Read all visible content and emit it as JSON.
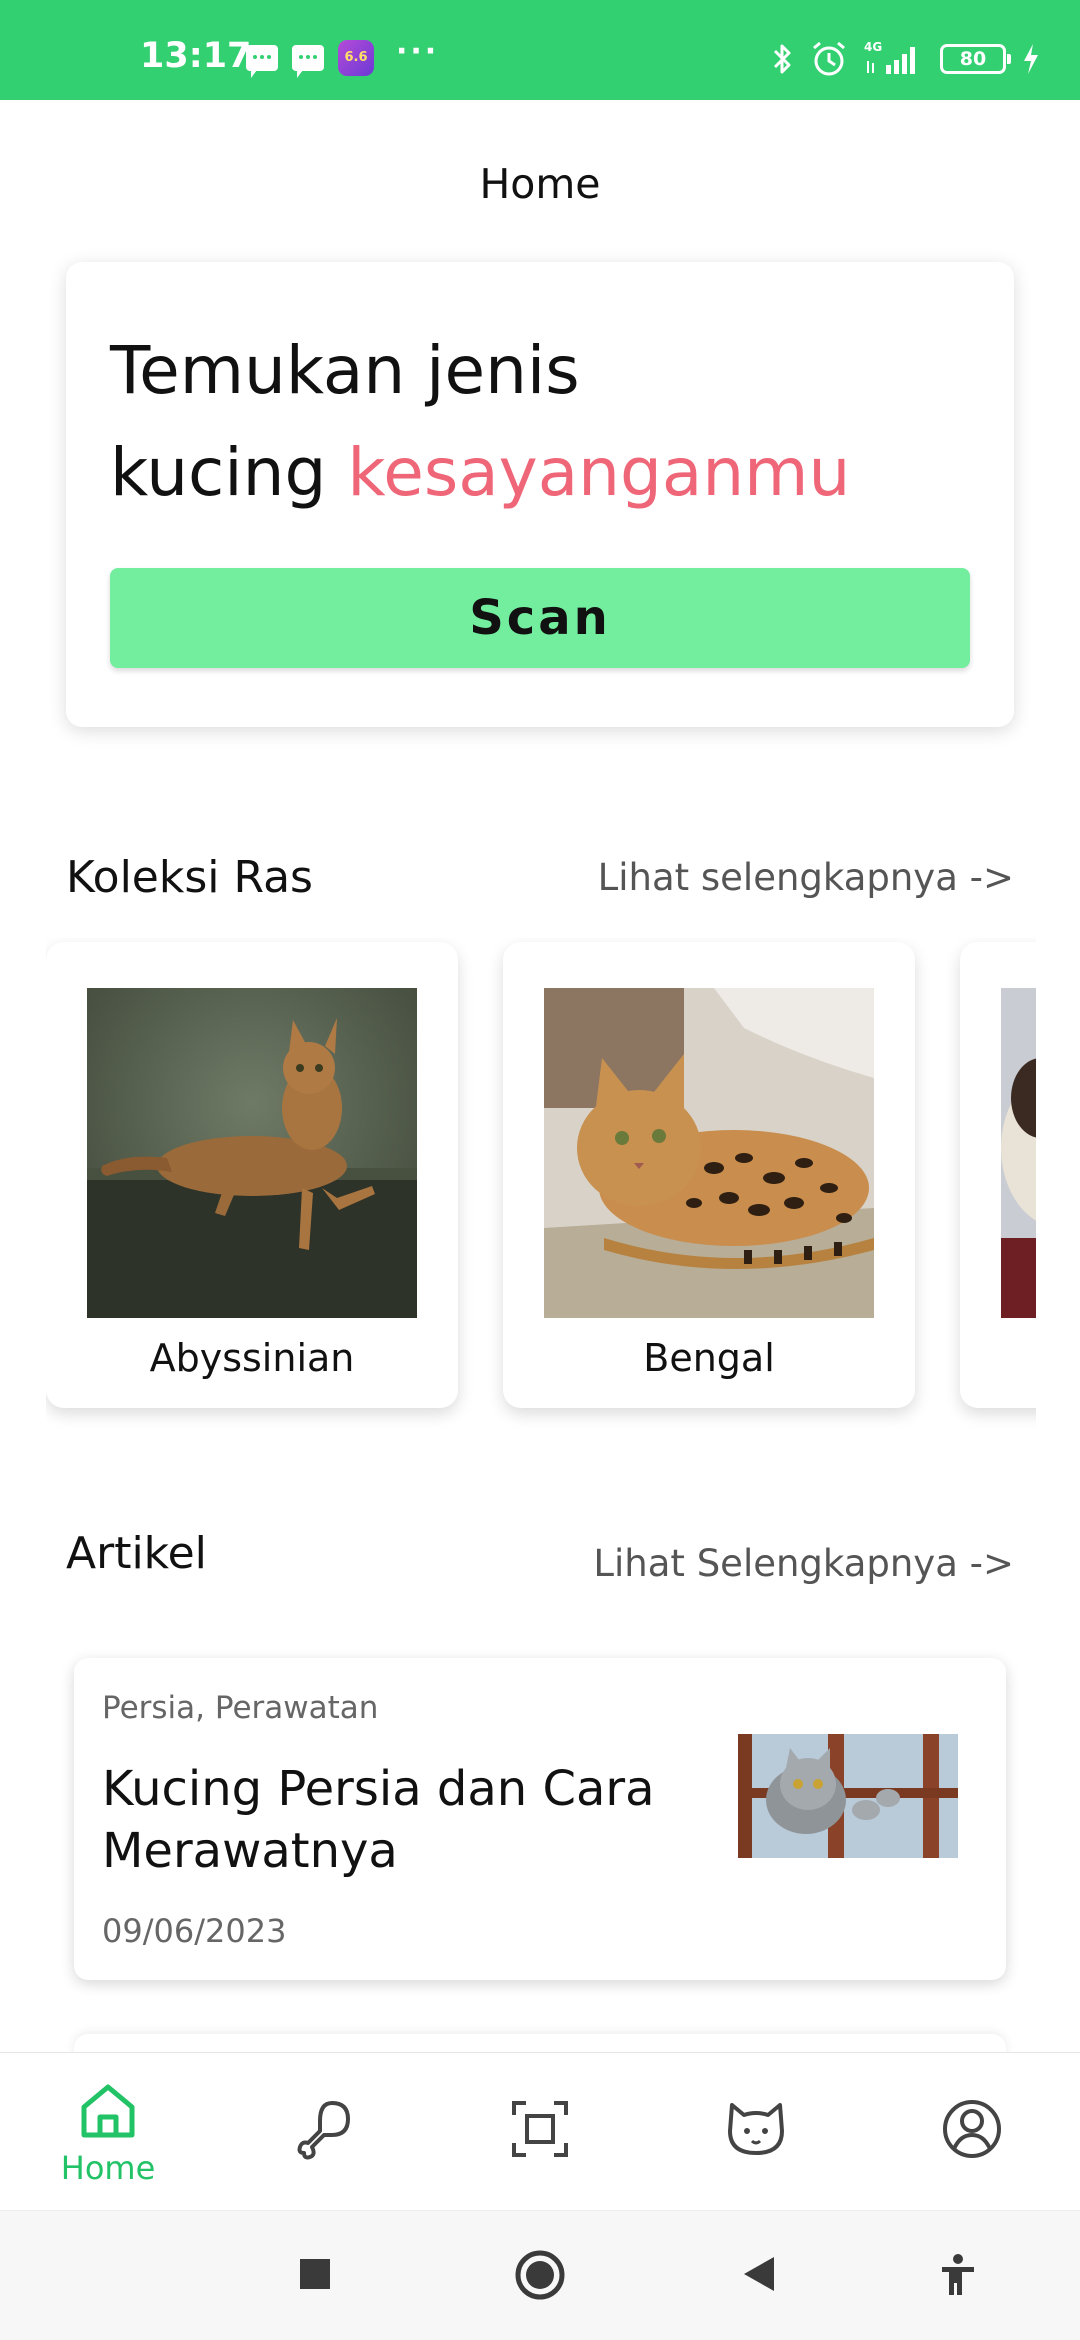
{
  "status_bar": {
    "time": "13:17",
    "app_badge": "6.6",
    "more": "···",
    "network": "4G",
    "battery": "80",
    "background": "#33d072"
  },
  "header": {
    "title": "Home"
  },
  "hero": {
    "title_line1": "Temukan jenis",
    "title_word": "kucing",
    "title_accent": "kesayanganmu",
    "accent_color": "#ee6677",
    "scan_label": "Scan",
    "scan_color": "#72ee9e"
  },
  "breeds": {
    "title": "Koleksi Ras",
    "more_link": "Lihat selengkapnya ->",
    "items": [
      {
        "name": "Abyssinian",
        "image": "abyssinian-cat-photo"
      },
      {
        "name": "Bengal",
        "image": "bengal-cat-photo"
      },
      {
        "name": "",
        "image": "siamese-cat-photo"
      }
    ]
  },
  "articles": {
    "title": "Artikel",
    "more_link": "Lihat Selengkapnya ->",
    "items": [
      {
        "tags": "Persia, Perawatan",
        "title": "Kucing Persia dan Cara Merawatnya",
        "date": "09/06/2023",
        "image": "persian-cat-photo"
      }
    ]
  },
  "bottom_nav": {
    "active_color": "#22c366",
    "items": [
      {
        "label": "Home",
        "icon": "home-icon",
        "active": true
      },
      {
        "label": "",
        "icon": "drumstick-icon",
        "active": false
      },
      {
        "label": "",
        "icon": "scan-frame-icon",
        "active": false
      },
      {
        "label": "",
        "icon": "cat-face-icon",
        "active": false
      },
      {
        "label": "",
        "icon": "profile-icon",
        "active": false
      }
    ]
  },
  "system_nav": {
    "buttons": [
      "recent-apps-icon",
      "home-circle-icon",
      "back-triangle-icon",
      "accessibility-icon"
    ]
  }
}
